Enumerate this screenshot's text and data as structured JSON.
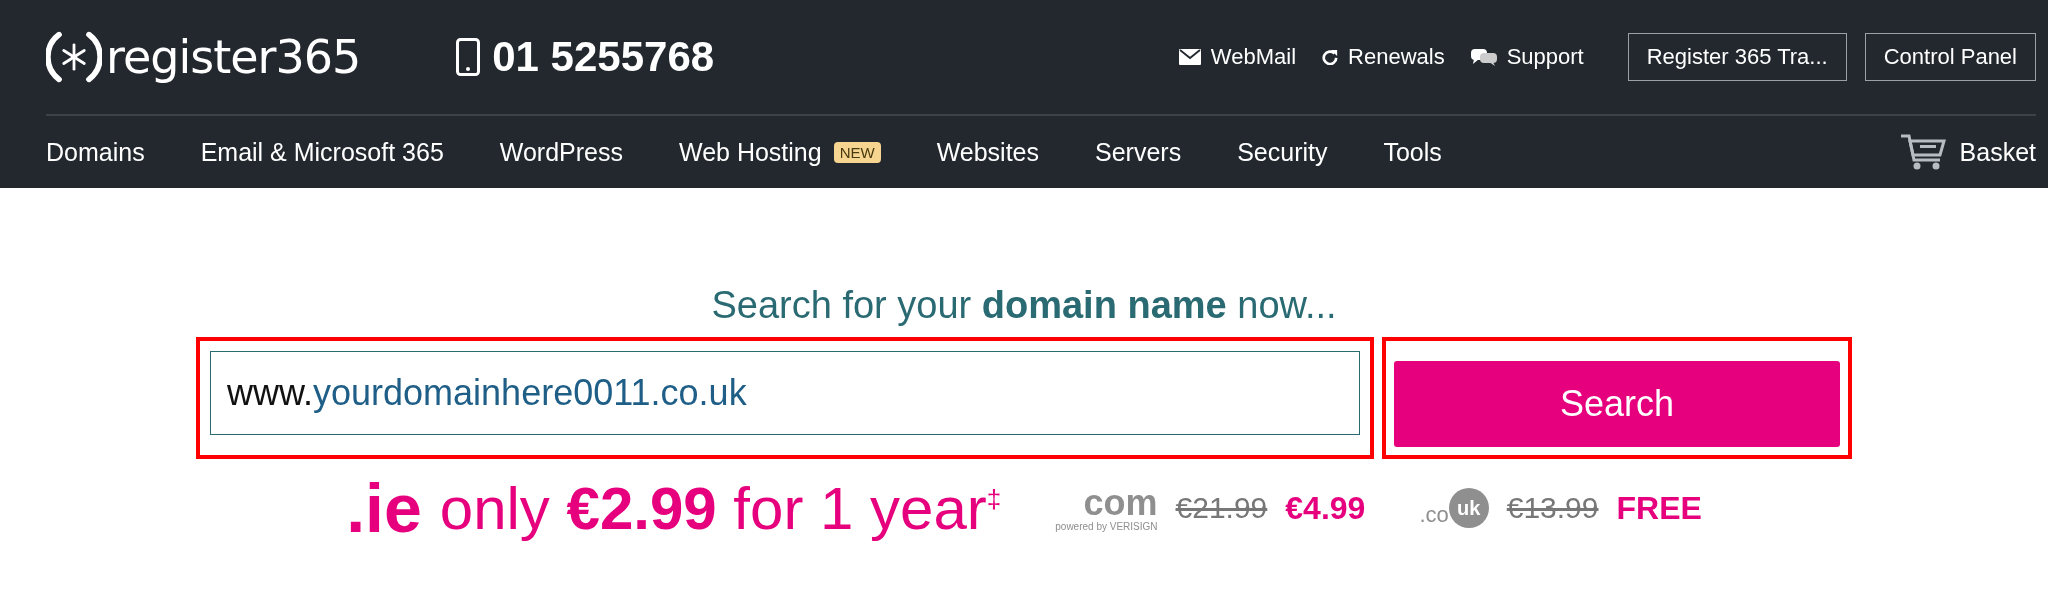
{
  "header": {
    "logo": "register365",
    "phone": "01 5255768",
    "links": [
      {
        "kind": "mail",
        "label": "WebMail"
      },
      {
        "kind": "renew",
        "label": "Renewals"
      },
      {
        "kind": "chat",
        "label": "Support"
      }
    ],
    "buttons": [
      "Register 365 Tra...",
      "Control Panel"
    ]
  },
  "nav": {
    "items": [
      {
        "label": "Domains"
      },
      {
        "label": "Email & Microsoft 365"
      },
      {
        "label": "WordPress"
      },
      {
        "label": "Web Hosting",
        "badge": "NEW"
      },
      {
        "label": "Websites"
      },
      {
        "label": "Servers"
      },
      {
        "label": "Security"
      },
      {
        "label": "Tools"
      }
    ],
    "basket": "Basket"
  },
  "search": {
    "heading": "Search for your **domain name** now...",
    "prefix": "www.",
    "value": "yourdomainhere0011.co.uk",
    "button": "Search"
  },
  "promo": {
    "logo": ".ie",
    "text": "only **€2.99** for 1 year$^{‡}$",
    "offers": [
      {
        "kind": "com",
        "logo": "com",
        "tagline": "powered by VERISIGN",
        "old_price": "€21.99",
        "price": "€4.99"
      },
      {
        "kind": "couk",
        "logo": ".co",
        "logo_badge": "uk",
        "old_price": "€13.99",
        "price": "FREE"
      }
    ]
  }
}
